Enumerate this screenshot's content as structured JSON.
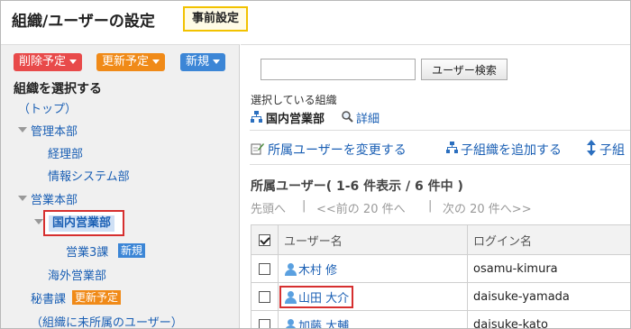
{
  "header": {
    "title": "組織/ユーザーの設定",
    "badge": "事前設定"
  },
  "left": {
    "buttons": {
      "delete_scheduled": "削除予定",
      "update_scheduled": "更新予定",
      "new": "新規"
    },
    "select_heading": "組織を選択する",
    "tree": {
      "top": "（トップ）",
      "admin_hq": "管理本部",
      "accounting": "経理部",
      "it_systems": "情報システム部",
      "sales_hq": "営業本部",
      "domestic_sales": "国内営業部",
      "sales_3": "営業3課",
      "sales_3_tag": "新規",
      "overseas_sales": "海外営業部",
      "secretary": "秘書課",
      "secretary_tag": "更新予定",
      "unassigned": "（組織に未所属のユーザー）"
    }
  },
  "right": {
    "search": {
      "value": "",
      "button": "ユーザー検索"
    },
    "selected_label": "選択している組織",
    "selected_org": "国内営業部",
    "detail_link": "詳細",
    "actions": {
      "change_members": "所属ユーザーを変更する",
      "add_child": "子組織を追加する",
      "reorder_child": "子組"
    },
    "members_heading": "所属ユーザー( 1-6 件表示 / 6 件中 )",
    "pager": {
      "first": "先頭へ",
      "prev": "<<前の 20 件へ",
      "next": "次の 20 件へ>>",
      "sep": "|"
    },
    "table": {
      "headers": [
        "ユーザー名",
        "ログイン名"
      ],
      "rows": [
        {
          "name": "木村 修",
          "login": "osamu-kimura"
        },
        {
          "name": "山田 大介",
          "login": "daisuke-yamada"
        },
        {
          "name": "加藤 大輔",
          "login": "daisuke-kato"
        }
      ]
    }
  },
  "colors": {
    "link": "#1a5fb4",
    "highlight_border": "#d62f2f",
    "badge_border": "#f2c200",
    "pill_red": "#e84a4a",
    "pill_orange": "#f08a18",
    "pill_blue": "#3c86d6"
  }
}
